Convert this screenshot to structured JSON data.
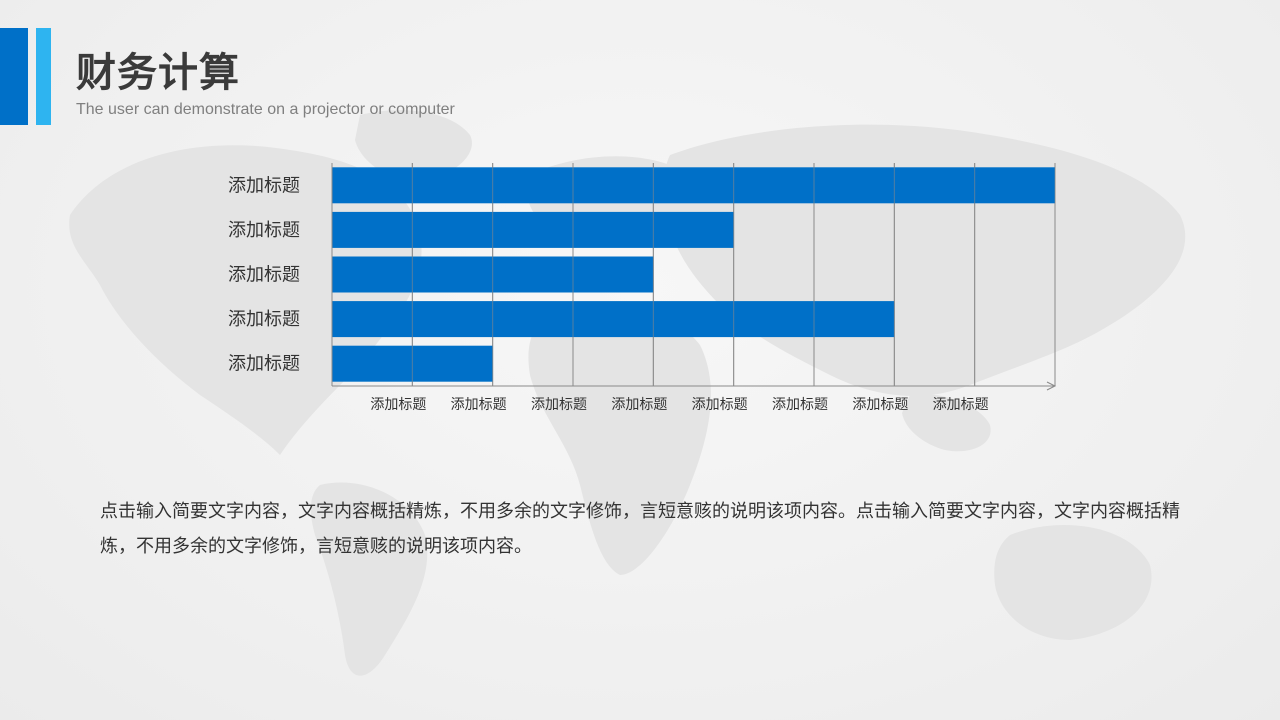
{
  "header": {
    "title": "财务计算",
    "subtitle": "The user can demonstrate on a projector or computer"
  },
  "colors": {
    "bar": "#0070c8",
    "accent_dark": "#0070c8",
    "accent_light": "#2eb4f0",
    "grid": "#8a8a8a"
  },
  "chart_data": {
    "type": "bar",
    "orientation": "horizontal",
    "categories": [
      "添加标题",
      "添加标题",
      "添加标题",
      "添加标题",
      "添加标题"
    ],
    "values": [
      9,
      5,
      4,
      7,
      2
    ],
    "x_tick_labels": [
      "添加标题",
      "添加标题",
      "添加标题",
      "添加标题",
      "添加标题",
      "添加标题",
      "添加标题",
      "添加标题"
    ],
    "xlim": [
      0,
      9
    ],
    "grid": true,
    "title": "",
    "xlabel": "",
    "ylabel": ""
  },
  "body": {
    "text": "点击输入简要文字内容，文字内容概括精炼，不用多余的文字修饰，言短意赅的说明该项内容。点击输入简要文字内容，文字内容概括精炼，不用多余的文字修饰，言短意赅的说明该项内容。"
  }
}
